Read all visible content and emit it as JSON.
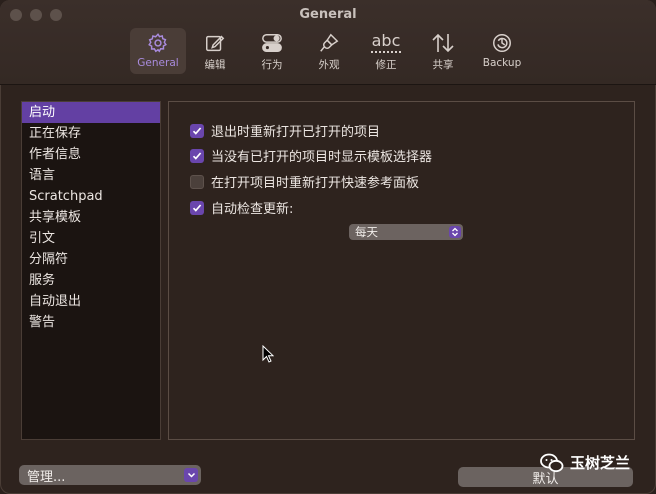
{
  "window": {
    "title": "General"
  },
  "toolbar": {
    "tabs": [
      {
        "label": "General",
        "icon": "gear-icon",
        "selected": true
      },
      {
        "label": "编辑",
        "icon": "pencil-square-icon"
      },
      {
        "label": "行为",
        "icon": "toggles-icon"
      },
      {
        "label": "外观",
        "icon": "paintbrush-icon"
      },
      {
        "label": "修正",
        "icon": "abc-spellcheck-icon",
        "icon_text": "abc"
      },
      {
        "label": "共享",
        "icon": "up-down-arrows-icon"
      },
      {
        "label": "Backup",
        "icon": "backup-clock-icon"
      }
    ]
  },
  "sidebar": {
    "items": [
      {
        "label": "启动",
        "selected": true
      },
      {
        "label": "正在保存"
      },
      {
        "label": "作者信息"
      },
      {
        "label": "语言"
      },
      {
        "label": "Scratchpad"
      },
      {
        "label": "共享模板"
      },
      {
        "label": "引文"
      },
      {
        "label": "分隔符"
      },
      {
        "label": "服务"
      },
      {
        "label": "自动退出"
      },
      {
        "label": "警告"
      }
    ]
  },
  "startup": {
    "options": [
      {
        "label": "退出时重新打开已打开的项目",
        "checked": true
      },
      {
        "label": "当没有已打开的项目时显示模板选择器",
        "checked": true
      },
      {
        "label": "在打开项目时重新打开快速参考面板",
        "checked": false
      },
      {
        "label": "自动检查更新:",
        "checked": true
      }
    ],
    "update_frequency": "每天"
  },
  "footer": {
    "manage_label": "管理...",
    "default_label": "默认"
  },
  "watermark": {
    "text": "玉树芝兰"
  },
  "colors": {
    "accent": "#6a46ad",
    "selection": "#6340a3",
    "tab_selected_text": "#a98bdd"
  }
}
